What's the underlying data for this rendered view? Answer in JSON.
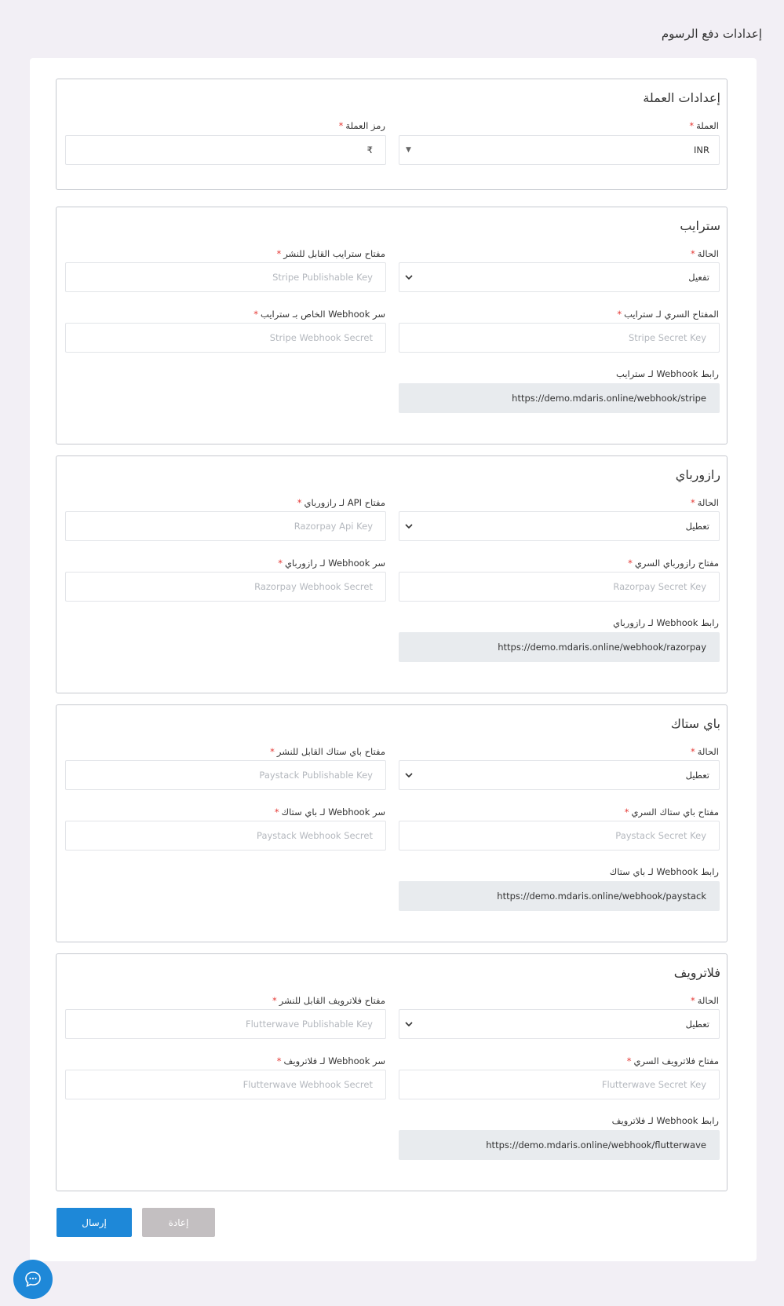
{
  "page": {
    "title": "إعدادات دفع الرسوم"
  },
  "currency": {
    "title": "إعدادات العملة",
    "currency_label": "العملة",
    "currency_value": "INR",
    "symbol_label": "رمز العملة",
    "symbol_value": "₹"
  },
  "stripe": {
    "title": "سترايب",
    "status_label": "الحالة",
    "status_value": "تفعيل",
    "publishable_label": "مفتاح سترايب القابل للنشر",
    "publishable_placeholder": "Stripe Publishable Key",
    "secret_label": "المفتاح السري لـ سترايب",
    "secret_placeholder": "Stripe Secret Key",
    "webhook_secret_label": "سر Webhook الخاص بـ سترايب",
    "webhook_secret_placeholder": "Stripe Webhook Secret",
    "webhook_url_label": "رابط Webhook لـ سترايب",
    "webhook_url_value": "https://demo.mdaris.online/webhook/stripe"
  },
  "razorpay": {
    "title": "رازورباي",
    "status_label": "الحالة",
    "status_value": "تعطيل",
    "api_label": "مفتاح API لـ رازورباي",
    "api_placeholder": "Razorpay Api Key",
    "secret_label": "مفتاح رازورباي السري",
    "secret_placeholder": "Razorpay Secret Key",
    "webhook_secret_label": "سر Webhook لـ رازورباي",
    "webhook_secret_placeholder": "Razorpay Webhook Secret",
    "webhook_url_label": "رابط Webhook لـ رازورباي",
    "webhook_url_value": "https://demo.mdaris.online/webhook/razorpay"
  },
  "paystack": {
    "title": "باي ستاك",
    "status_label": "الحالة",
    "status_value": "تعطيل",
    "publishable_label": "مفتاح باي ستاك القابل للنشر",
    "publishable_placeholder": "Paystack Publishable Key",
    "secret_label": "مفتاح باي ستاك السري",
    "secret_placeholder": "Paystack Secret Key",
    "webhook_secret_label": "سر Webhook لـ باي ستاك",
    "webhook_secret_placeholder": "Paystack Webhook Secret",
    "webhook_url_label": "رابط Webhook لـ باي ستاك",
    "webhook_url_value": "https://demo.mdaris.online/webhook/paystack"
  },
  "flutterwave": {
    "title": "فلاترويف",
    "status_label": "الحالة",
    "status_value": "تعطيل",
    "publishable_label": "مفتاح فلاترويف القابل للنشر",
    "publishable_placeholder": "Flutterwave Publishable Key",
    "secret_label": "مفتاح فلاترويف السري",
    "secret_placeholder": "Flutterwave Secret Key",
    "webhook_secret_label": "سر Webhook لـ فلاترويف",
    "webhook_secret_placeholder": "Flutterwave Webhook Secret",
    "webhook_url_label": "رابط Webhook لـ فلاترويف",
    "webhook_url_value": "https://demo.mdaris.online/webhook/flutterwave"
  },
  "actions": {
    "submit_label": "إرسال",
    "reset_label": "إعادة"
  },
  "required_mark": "*",
  "icons": {
    "chat": "chat-bubble-icon",
    "select": "chevron-down-icon"
  },
  "colors": {
    "primary": "#1e88d8",
    "required": "#e53935",
    "reset": "#c3bfc1"
  }
}
